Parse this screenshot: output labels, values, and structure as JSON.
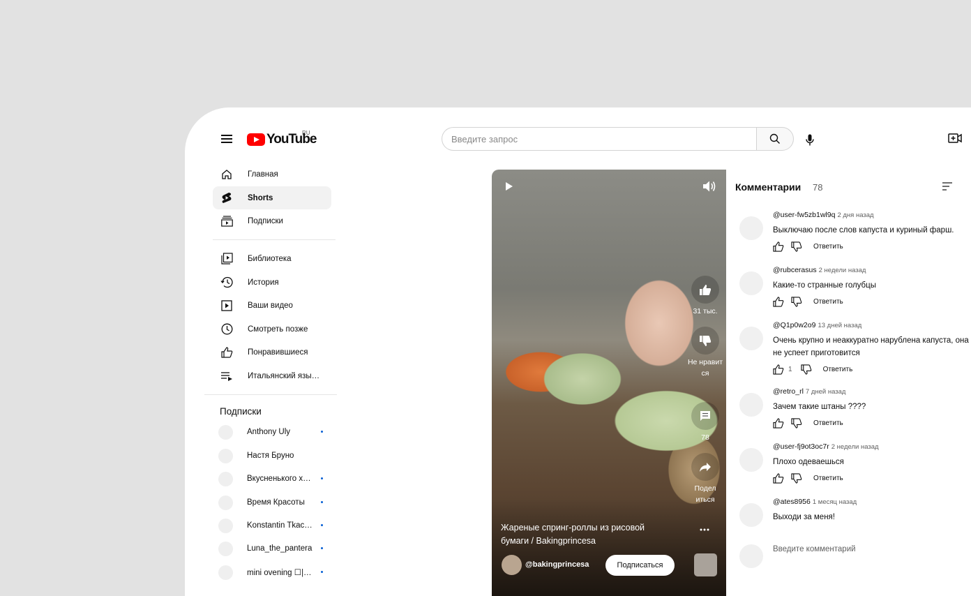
{
  "header": {
    "logo_text": "YouTube",
    "logo_region": "RU",
    "search_placeholder": "Введите запрос"
  },
  "sidebar": {
    "main_items": [
      {
        "label": "Главная",
        "icon": "home-icon"
      },
      {
        "label": "Shorts",
        "icon": "shorts-icon",
        "active": true
      },
      {
        "label": "Подписки",
        "icon": "subscriptions-icon"
      }
    ],
    "library_items": [
      {
        "label": "Библиотека",
        "icon": "library-icon"
      },
      {
        "label": "История",
        "icon": "history-icon"
      },
      {
        "label": "Ваши видео",
        "icon": "your-videos-icon"
      },
      {
        "label": "Смотреть позже",
        "icon": "watch-later-icon"
      },
      {
        "label": "Понравившиеся",
        "icon": "liked-icon"
      },
      {
        "label": "Итальянский язы…",
        "icon": "playlist-icon"
      }
    ],
    "subscriptions_title": "Подписки",
    "subscriptions": [
      {
        "name": "Anthony Uly",
        "new": true
      },
      {
        "name": "Настя Бруно",
        "new": false
      },
      {
        "name": "Вкусненького х…",
        "new": true
      },
      {
        "name": "Время Красоты",
        "new": true
      },
      {
        "name": "Konstantin Tkac…",
        "new": true
      },
      {
        "name": "Luna_the_pantera",
        "new": true
      },
      {
        "name": "mini ovening ☐|…",
        "new": true
      }
    ]
  },
  "short": {
    "likes": "31 тыс.",
    "dislike_label": "Не нравит ся",
    "comments_count": "78",
    "share_label": "Подел иться",
    "title": "Жареные спринг-роллы из рисовой бумаги / Bakingprincesa",
    "channel": "@bakingprincesa",
    "subscribe_label": "Подписаться"
  },
  "comments": {
    "title": "Комментарии",
    "count": "78",
    "reply_label": "Ответить",
    "input_placeholder": "Введите комментарий",
    "items": [
      {
        "author": "@user-fw5zb1wl9q",
        "time": "2 дня назад",
        "text": "Выключаю после слов капуста и куриный фарш.",
        "likes": ""
      },
      {
        "author": "@rubcerasus",
        "time": "2 недели назад",
        "text": "Какие-то странные голубцы",
        "likes": ""
      },
      {
        "author": "@Q1p0w2o9",
        "time": "13 дней назад",
        "text": "Очень крупно и неаккуратно нарублена капуста, она не успеет приготовится",
        "likes": "1"
      },
      {
        "author": "@retro_rl",
        "time": "7 дней назад",
        "text": "Зачем такие штаны ????",
        "likes": ""
      },
      {
        "author": "@user-fj9ot3oc7r",
        "time": "2 недели назад",
        "text": "Плохо одеваешься",
        "likes": ""
      },
      {
        "author": "@ates8956",
        "time": "1 месяц назад",
        "text": "Выходи за меня!",
        "likes": ""
      }
    ]
  },
  "colors": {
    "brand_red": "#ff0000",
    "page_bg": "#e2e2e2",
    "subscription_dot": "#065fd4"
  }
}
